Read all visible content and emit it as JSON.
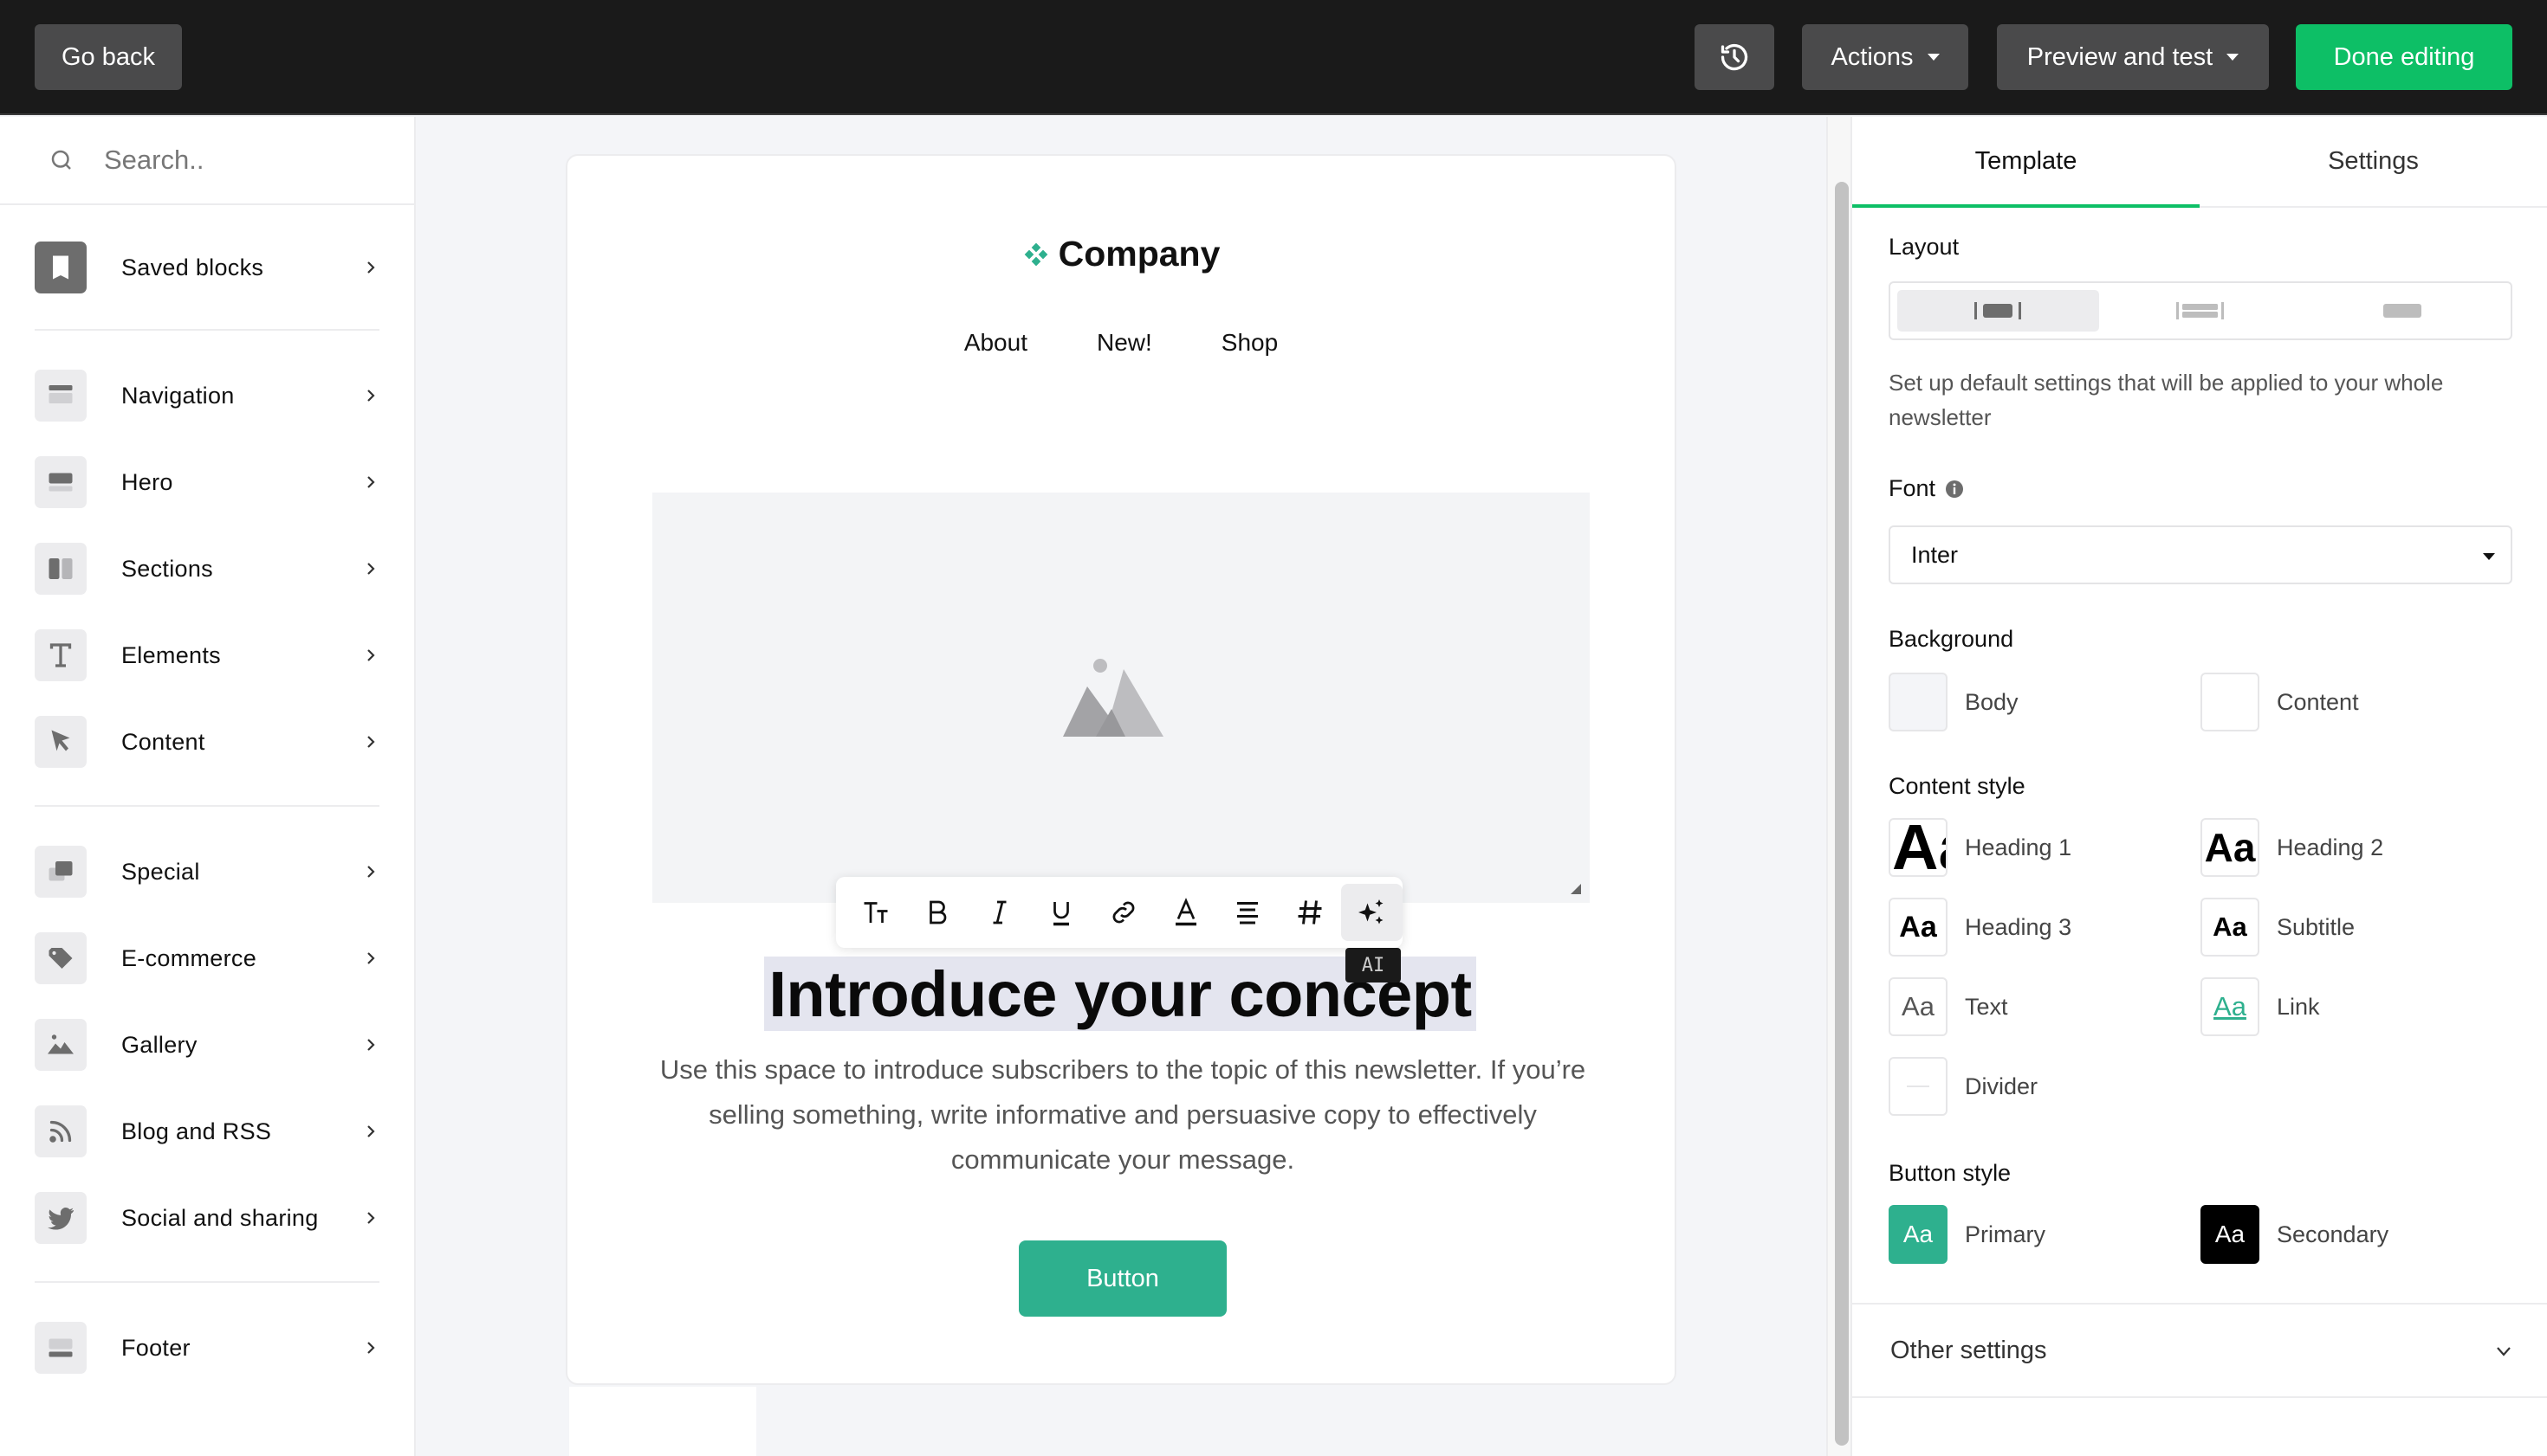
{
  "topbar": {
    "go_back": "Go back",
    "history_icon": "history-icon",
    "actions": "Actions",
    "preview": "Preview and test",
    "done": "Done editing"
  },
  "sidebar": {
    "search_placeholder": "Search..",
    "items": [
      {
        "label": "Saved blocks",
        "icon": "bookmark-icon"
      },
      {
        "label": "Navigation",
        "icon": "navigation-block-icon"
      },
      {
        "label": "Hero",
        "icon": "hero-block-icon"
      },
      {
        "label": "Sections",
        "icon": "sections-icon"
      },
      {
        "label": "Elements",
        "icon": "text-t-icon"
      },
      {
        "label": "Content",
        "icon": "cursor-arrow-icon"
      },
      {
        "label": "Special",
        "icon": "stacked-cards-icon"
      },
      {
        "label": "E-commerce",
        "icon": "tag-icon"
      },
      {
        "label": "Gallery",
        "icon": "image-icon"
      },
      {
        "label": "Blog and RSS",
        "icon": "rss-icon"
      },
      {
        "label": "Social and sharing",
        "icon": "twitter-bird-icon"
      },
      {
        "label": "Footer",
        "icon": "footer-block-icon"
      }
    ]
  },
  "email": {
    "logo_text": "Company",
    "nav": [
      "About",
      "New!",
      "Shop"
    ],
    "headline": "Introduce your concept",
    "body": "Use this space to introduce subscribers to the topic of this newsletter. If you’re selling something, write informative and persuasive copy to effectively communicate your message.",
    "button": "Button",
    "toolbar": [
      "text-size-icon",
      "bold-icon",
      "italic-icon",
      "underline-icon",
      "link-icon",
      "text-color-icon",
      "align-icon",
      "hashtag-icon",
      "ai-sparkle-icon"
    ],
    "tooltip": "AI"
  },
  "panel": {
    "tabs": [
      "Template",
      "Settings"
    ],
    "active_tab": "Template",
    "layout_title": "Layout",
    "layout_options": [
      "boxed",
      "full-width-bars",
      "full-width"
    ],
    "layout_selected": "boxed",
    "description": "Set up default settings that will be applied to your whole newsletter",
    "font_title": "Font",
    "font_value": "Inter",
    "background_title": "Background",
    "background": [
      {
        "label": "Body",
        "color": "#f4f5f8"
      },
      {
        "label": "Content",
        "color": "#ffffff"
      }
    ],
    "content_style_title": "Content style",
    "content_styles": [
      {
        "label": "Heading 1",
        "sample": "Aa"
      },
      {
        "label": "Heading 2",
        "sample": "Aa"
      },
      {
        "label": "Heading 3",
        "sample": "Aa"
      },
      {
        "label": "Subtitle",
        "sample": "Aa"
      },
      {
        "label": "Text",
        "sample": "Aa"
      },
      {
        "label": "Link",
        "sample": "Aa"
      },
      {
        "label": "Divider",
        "sample": ""
      }
    ],
    "button_style_title": "Button style",
    "button_styles": [
      {
        "label": "Primary",
        "sample": "Aa",
        "color": "#2eb08e"
      },
      {
        "label": "Secondary",
        "sample": "Aa",
        "color": "#000000"
      }
    ],
    "other_settings": "Other settings"
  },
  "colors": {
    "accent_green": "#0dbf66",
    "brand_teal": "#2eb08e",
    "topbar": "#1a1a1a"
  }
}
